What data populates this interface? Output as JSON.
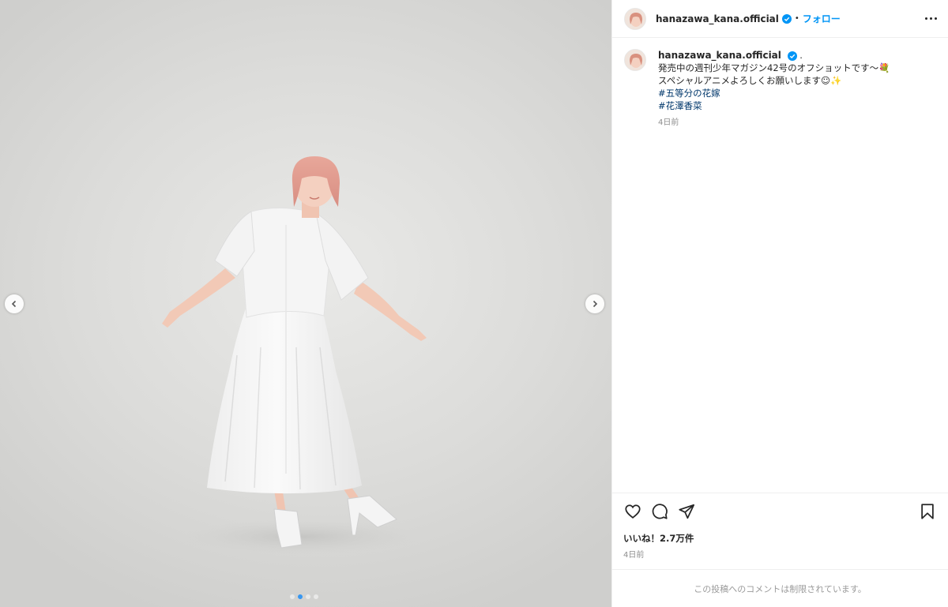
{
  "header": {
    "username": "hanazawa_kana.official",
    "separator": "•",
    "follow_label": "フォロー"
  },
  "caption": {
    "username": "hanazawa_kana.official",
    "after_name": ".",
    "lines": [
      "発売中の週刊少年マガジン42号のオフショットです〜💐",
      "スペシャルアニメよろしくお願いします☺✨"
    ],
    "hashtags": [
      "#五等分の花嫁",
      "#花澤香菜"
    ],
    "time": "4日前"
  },
  "likes": "いいね！2.7万件",
  "post_time": "4日前",
  "comments_disabled": "この投稿へのコメントは制限されています。",
  "colors": {
    "accent": "#0095f6",
    "verified": "#0095f6",
    "hashtag": "#00376b",
    "muted": "#8e8e8e"
  },
  "icons": {
    "verified": "verified-badge-icon",
    "more": "more-options-icon",
    "like": "heart-icon",
    "comment": "comment-icon",
    "share": "share-icon",
    "save": "bookmark-icon",
    "prev": "chevron-left-icon",
    "next": "chevron-right-icon"
  }
}
